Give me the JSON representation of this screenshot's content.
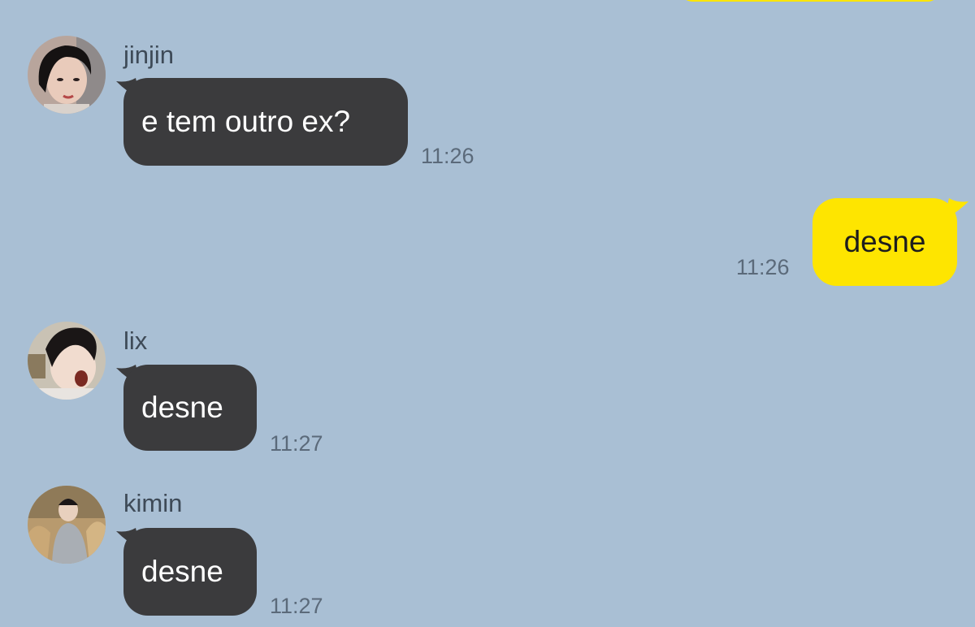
{
  "colors": {
    "background": "#a9bfd4",
    "incoming_bubble": "#3b3b3d",
    "outgoing_bubble": "#fee500",
    "name_text": "#3e4a57",
    "time_text": "#5b6a7a"
  },
  "messages": [
    {
      "sender": "jinjin",
      "text": "e tem outro ex?",
      "time": "11:26"
    },
    {
      "sender": "",
      "text": "desne",
      "time": "11:26"
    },
    {
      "sender": "lix",
      "text": "desne",
      "time": "11:27"
    },
    {
      "sender": "kimin",
      "text": "desne",
      "time": "11:27"
    }
  ]
}
